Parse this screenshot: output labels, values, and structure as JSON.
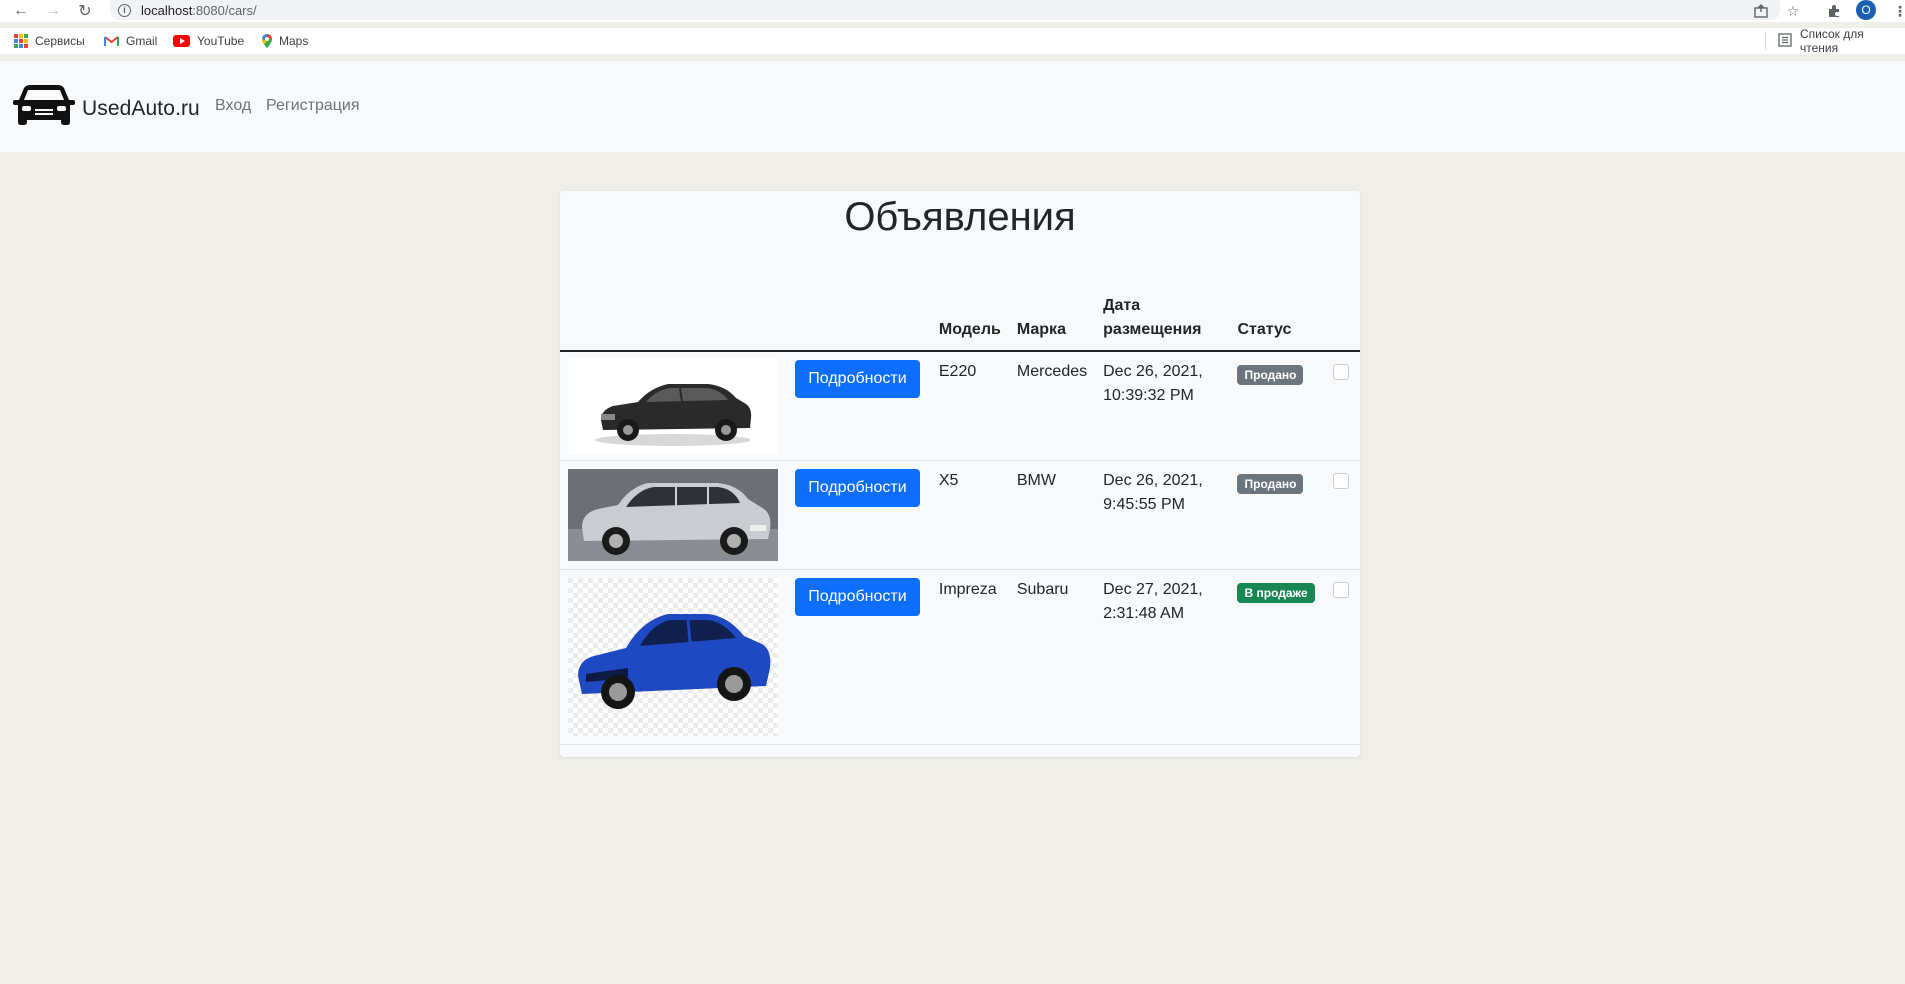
{
  "browser": {
    "url_host": "localhost",
    "url_path": ":8080/cars/",
    "profile_initial": "O"
  },
  "bookmarks": [
    {
      "label": "Сервисы",
      "icon": "apps-icon"
    },
    {
      "label": "Gmail",
      "icon": "gmail-icon"
    },
    {
      "label": "YouTube",
      "icon": "youtube-icon"
    },
    {
      "label": "Maps",
      "icon": "maps-icon"
    }
  ],
  "reading_list_label": "Список для чтения",
  "navbar": {
    "brand": "UsedAuto.ru",
    "login": "Вход",
    "register": "Регистрация"
  },
  "page": {
    "title": "Объявления"
  },
  "table": {
    "headers": {
      "model": "Модель",
      "brand": "Марка",
      "date": "Дата размещения",
      "status": "Статус"
    },
    "rows": [
      {
        "button": "Подробности",
        "model": "E220",
        "brand": "Mercedes",
        "date": "Dec 26, 2021, 10:39:32 PM",
        "status": "Продано",
        "status_color": "#6c757d",
        "image": "black-mercedes-sedan",
        "checked": false
      },
      {
        "button": "Подробности",
        "model": "X5",
        "brand": "BMW",
        "date": "Dec 26, 2021, 9:45:55 PM",
        "status": "Продано",
        "status_color": "#6c757d",
        "image": "silver-bmw-suv",
        "checked": false
      },
      {
        "button": "Подробности",
        "model": "Impreza",
        "brand": "Subaru",
        "date": "Dec 27, 2021, 2:31:48 AM",
        "status": "В продаже",
        "status_color": "#198754",
        "image": "blue-subaru-sedan",
        "checked": false
      }
    ]
  },
  "colors": {
    "primary": "#0d6efd",
    "sold_badge": "#6c757d",
    "sale_badge": "#198754",
    "page_bg": "#efeee9",
    "navbar_bg": "#f8f9fa"
  }
}
